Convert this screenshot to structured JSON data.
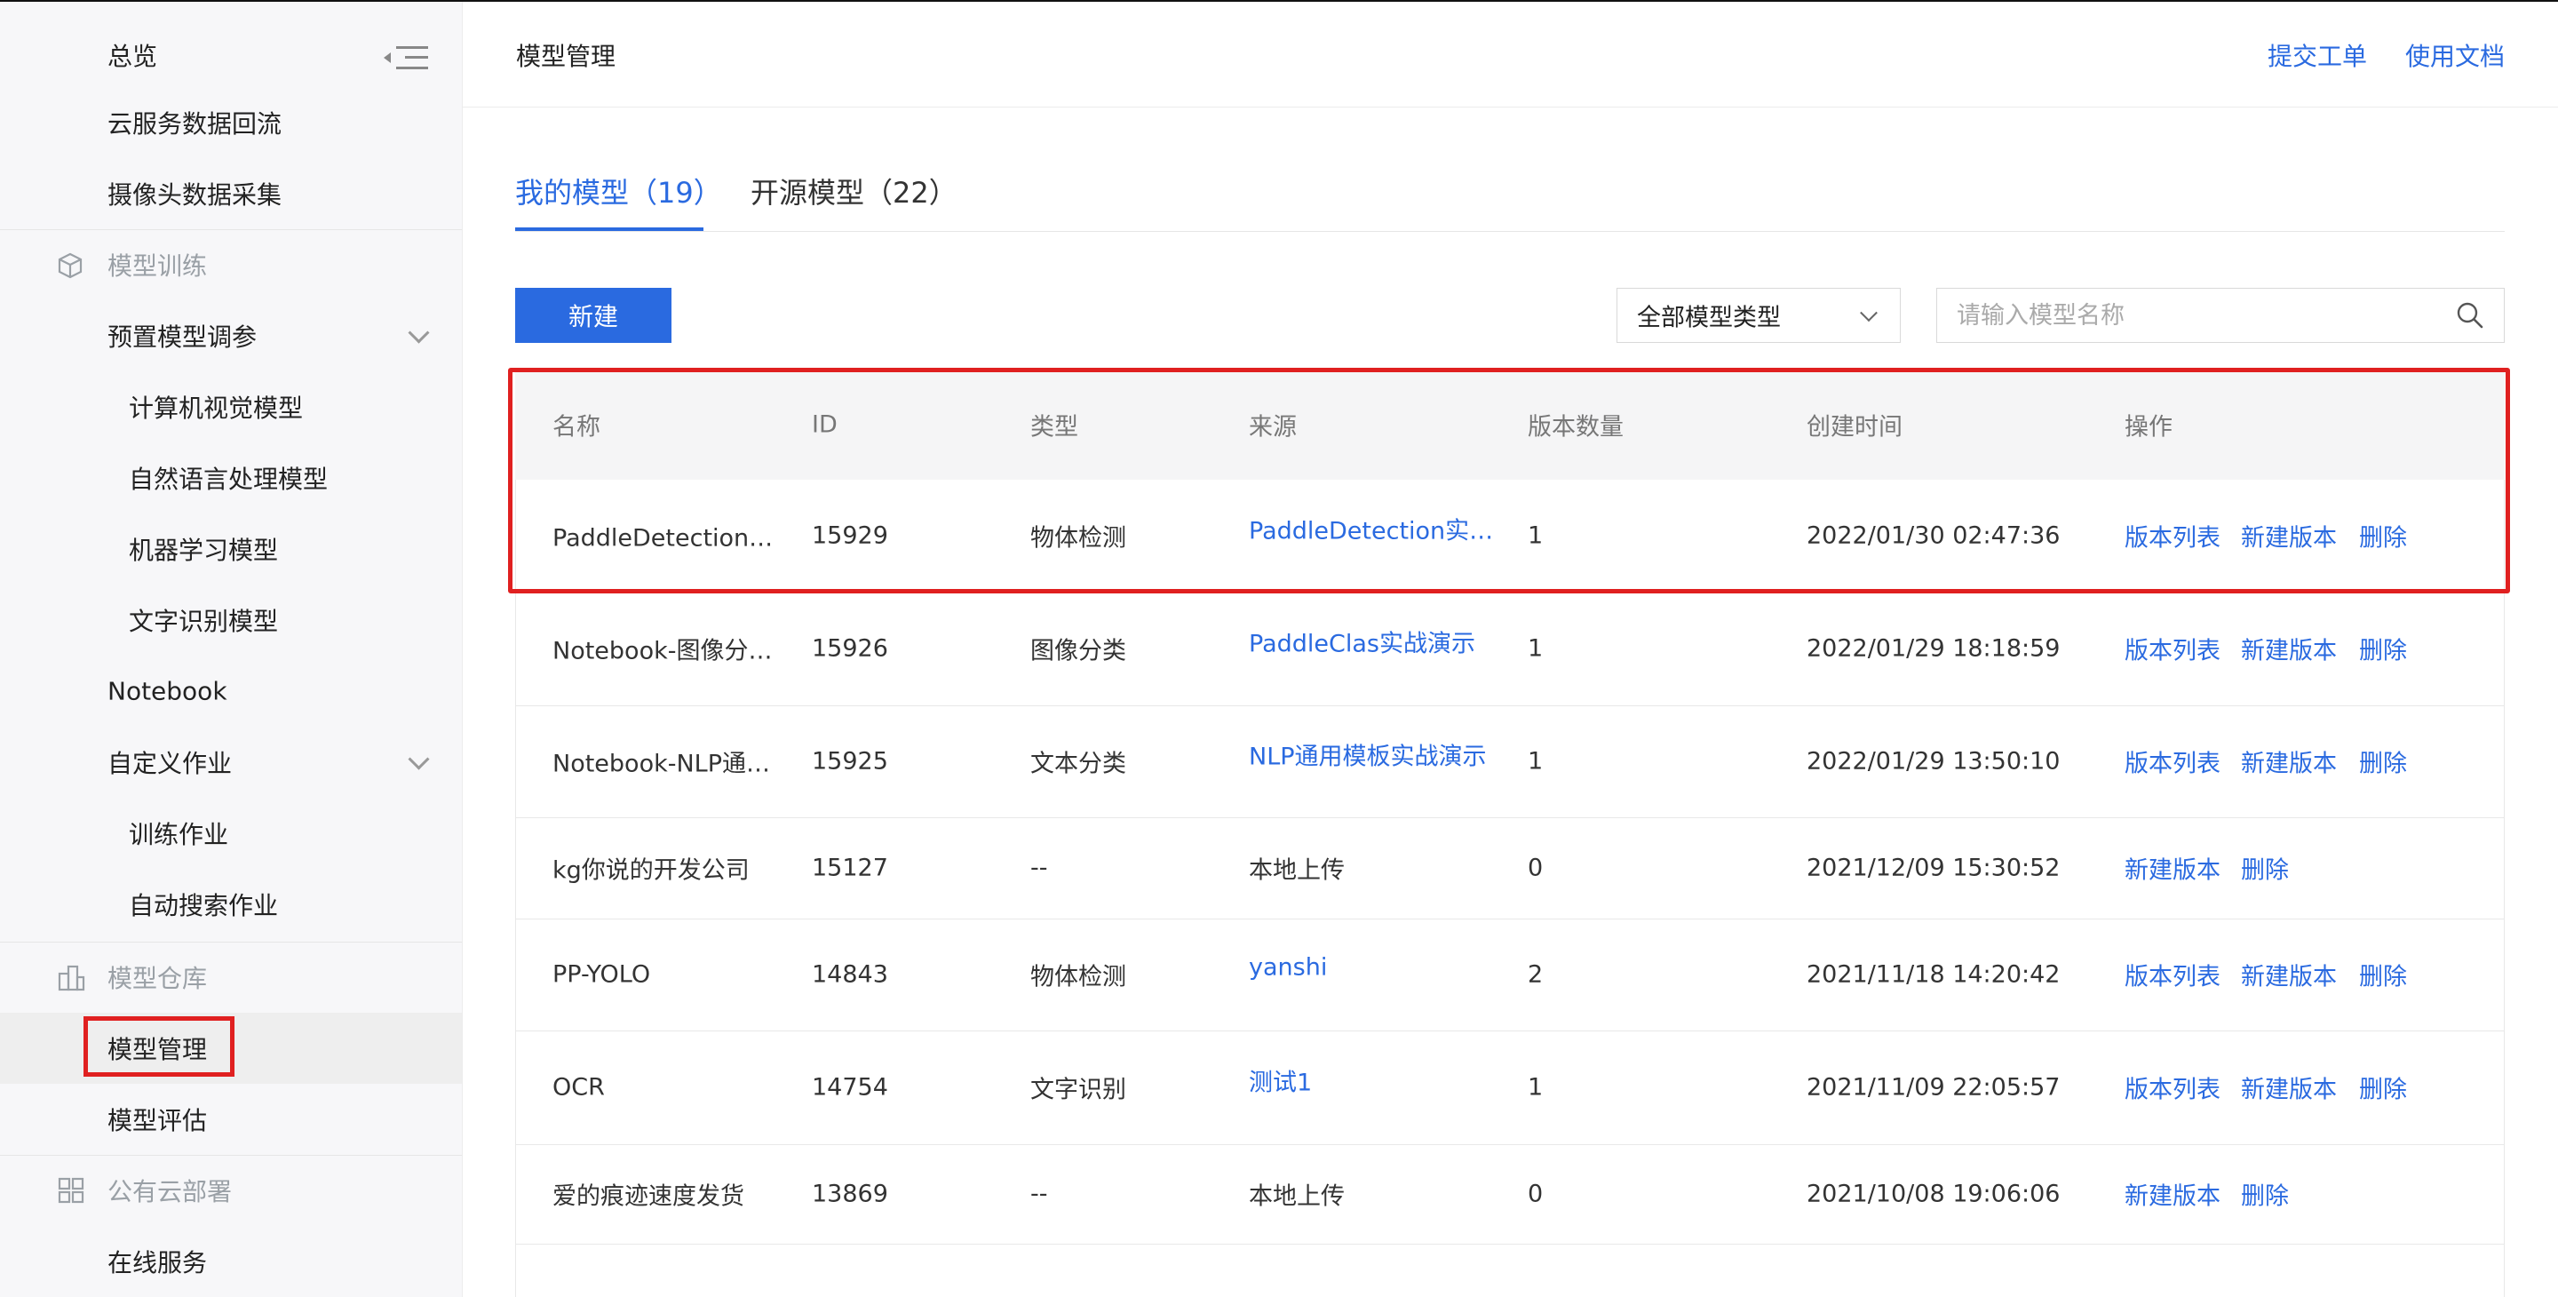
{
  "sidebar": {
    "top_title": "总览",
    "items": [
      {
        "label": "云服务数据回流"
      },
      {
        "label": "摄像头数据采集"
      },
      {
        "label": "模型训练"
      },
      {
        "label": "预置模型调参"
      },
      {
        "label": "计算机视觉模型"
      },
      {
        "label": "自然语言处理模型"
      },
      {
        "label": "机器学习模型"
      },
      {
        "label": "文字识别模型"
      },
      {
        "label": "Notebook"
      },
      {
        "label": "自定义作业"
      },
      {
        "label": "训练作业"
      },
      {
        "label": "自动搜索作业"
      },
      {
        "label": "模型仓库"
      },
      {
        "label": "模型管理"
      },
      {
        "label": "模型评估"
      },
      {
        "label": "公有云部署"
      },
      {
        "label": "在线服务"
      }
    ]
  },
  "header": {
    "title": "模型管理",
    "submit_ticket": "提交工单",
    "docs": "使用文档"
  },
  "tabs": [
    {
      "label": "我的模型（19）"
    },
    {
      "label": "开源模型（22）"
    }
  ],
  "toolbar": {
    "new_label": "新建",
    "filter_value": "全部模型类型",
    "search_placeholder": "请输入模型名称"
  },
  "table": {
    "columns": [
      "名称",
      "ID",
      "类型",
      "来源",
      "版本数量",
      "创建时间",
      "操作"
    ],
    "rows": [
      {
        "name": "PaddleDetection实…",
        "id": "15929",
        "type": "物体检测",
        "source": "PaddleDetection实…",
        "versions": "1",
        "created": "2022/01/30 02:47:36",
        "ops": [
          "版本列表",
          "新建版本",
          "删除"
        ]
      },
      {
        "name": "Notebook-图像分…",
        "id": "15926",
        "type": "图像分类",
        "source": "PaddleClas实战演示",
        "versions": "1",
        "created": "2022/01/29 18:18:59",
        "ops": [
          "版本列表",
          "新建版本",
          "删除"
        ]
      },
      {
        "name": "Notebook-NLP通…",
        "id": "15925",
        "type": "文本分类",
        "source": "NLP通用模板实战演示",
        "versions": "1",
        "created": "2022/01/29 13:50:10",
        "ops": [
          "版本列表",
          "新建版本",
          "删除"
        ]
      },
      {
        "name": "kg你说的开发公司",
        "id": "15127",
        "type": "--",
        "source": "本地上传",
        "versions": "0",
        "created": "2021/12/09 15:30:52",
        "ops": [
          "新建版本",
          "删除"
        ]
      },
      {
        "name": "PP-YOLO",
        "id": "14843",
        "type": "物体检测",
        "source": "yanshi",
        "versions": "2",
        "created": "2021/11/18 14:20:42",
        "ops": [
          "版本列表",
          "新建版本",
          "删除"
        ]
      },
      {
        "name": "OCR",
        "id": "14754",
        "type": "文字识别",
        "source": "测试1",
        "versions": "1",
        "created": "2021/11/09 22:05:57",
        "ops": [
          "版本列表",
          "新建版本",
          "删除"
        ]
      },
      {
        "name": "爱的痕迹速度发货",
        "id": "13869",
        "type": "--",
        "source": "本地上传",
        "versions": "0",
        "created": "2021/10/08 19:06:06",
        "ops": [
          "新建版本",
          "删除"
        ]
      },
      {
        "name": "",
        "id": "",
        "type": "",
        "source": "",
        "versions": "",
        "created": "",
        "ops": []
      }
    ]
  },
  "colors": {
    "accent": "#2a6ae0",
    "highlight": "#e02020"
  }
}
